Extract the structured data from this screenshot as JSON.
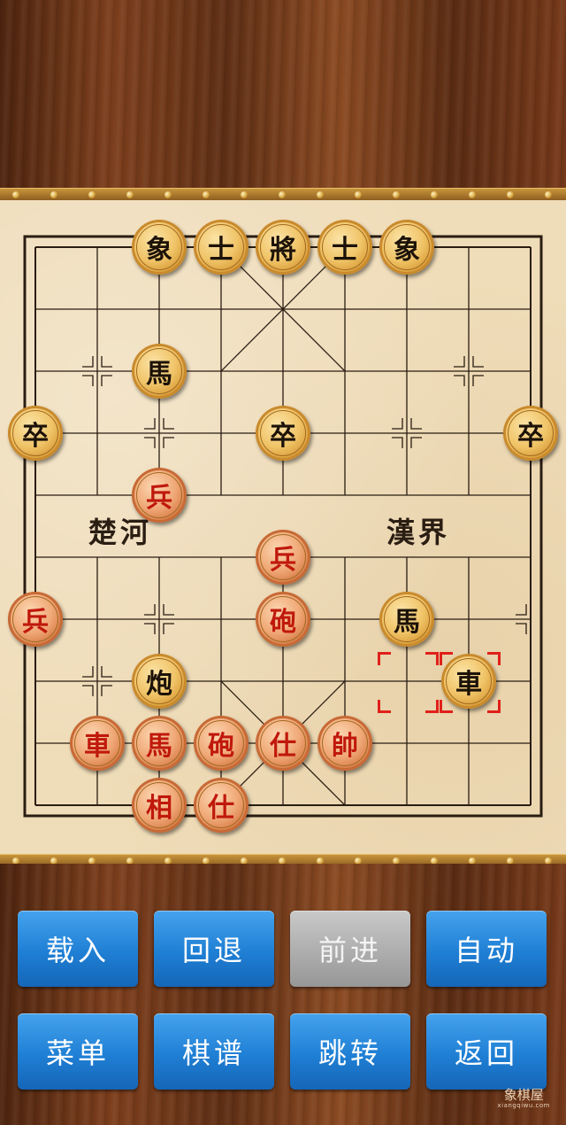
{
  "board": {
    "river_left": "楚河",
    "river_right": "漢界",
    "pieces": [
      {
        "char": "象",
        "side": "black",
        "col": 2,
        "row": 0
      },
      {
        "char": "士",
        "side": "black",
        "col": 3,
        "row": 0
      },
      {
        "char": "將",
        "side": "black",
        "col": 4,
        "row": 0
      },
      {
        "char": "士",
        "side": "black",
        "col": 5,
        "row": 0
      },
      {
        "char": "象",
        "side": "black",
        "col": 6,
        "row": 0
      },
      {
        "char": "馬",
        "side": "black",
        "col": 2,
        "row": 2
      },
      {
        "char": "卒",
        "side": "black",
        "col": 0,
        "row": 3
      },
      {
        "char": "卒",
        "side": "black",
        "col": 4,
        "row": 3
      },
      {
        "char": "卒",
        "side": "black",
        "col": 8,
        "row": 3
      },
      {
        "char": "兵",
        "side": "red",
        "col": 2,
        "row": 4
      },
      {
        "char": "兵",
        "side": "red",
        "col": 4,
        "row": 5
      },
      {
        "char": "兵",
        "side": "red",
        "col": 0,
        "row": 6
      },
      {
        "char": "砲",
        "side": "red",
        "col": 4,
        "row": 6
      },
      {
        "char": "馬",
        "side": "black",
        "col": 6,
        "row": 6
      },
      {
        "char": "炮",
        "side": "black",
        "col": 2,
        "row": 7
      },
      {
        "char": "車",
        "side": "black",
        "col": 7,
        "row": 7
      },
      {
        "char": "車",
        "side": "red",
        "col": 1,
        "row": 8
      },
      {
        "char": "馬",
        "side": "red",
        "col": 2,
        "row": 8
      },
      {
        "char": "砲",
        "side": "red",
        "col": 3,
        "row": 8
      },
      {
        "char": "仕",
        "side": "red",
        "col": 4,
        "row": 8
      },
      {
        "char": "帥",
        "side": "red",
        "col": 5,
        "row": 8
      },
      {
        "char": "相",
        "side": "red",
        "col": 2,
        "row": 9
      },
      {
        "char": "仕",
        "side": "red",
        "col": 3,
        "row": 9
      }
    ],
    "selection_from": {
      "col": 6,
      "row": 7
    },
    "selection_to": {
      "col": 7,
      "row": 7
    }
  },
  "controls": {
    "load": "载入",
    "undo": "回退",
    "forward": "前进",
    "auto": "自动",
    "menu": "菜单",
    "manual": "棋谱",
    "jump": "跳转",
    "back": "返回"
  },
  "watermark": {
    "text": "象棋屋",
    "sub": "xiangqiwu.com"
  }
}
